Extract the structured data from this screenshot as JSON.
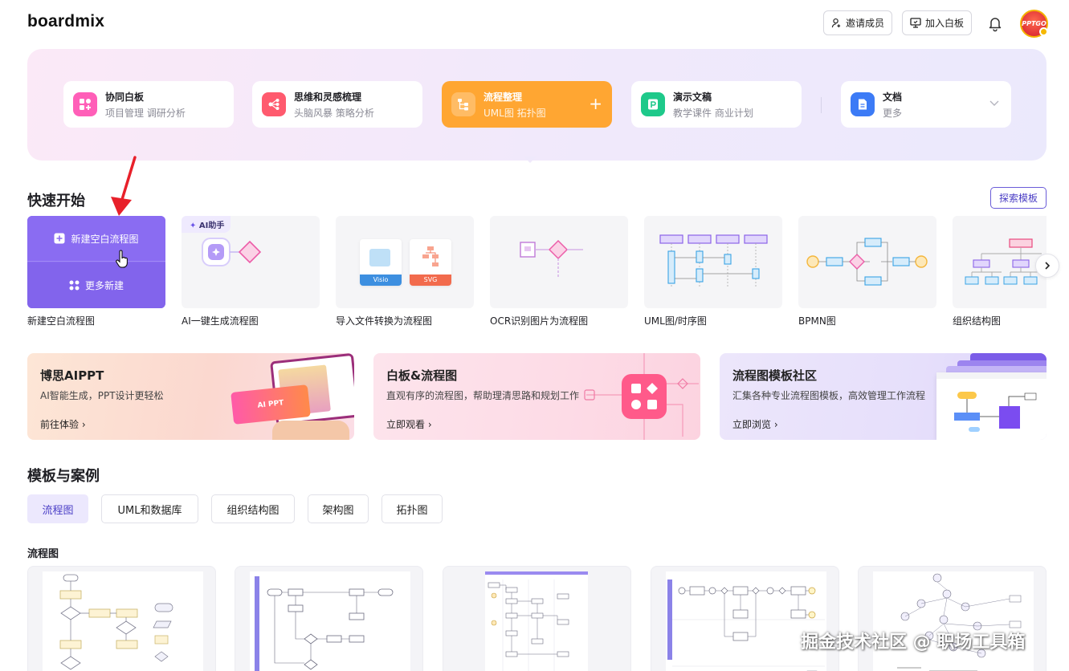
{
  "header": {
    "logo": "boardmix",
    "invite_label": "邀请成员",
    "join_label": "加入白板",
    "avatar_text": "PPTGO"
  },
  "hero": {
    "categories": [
      {
        "title": "协同白板",
        "sub": "项目管理 调研分析",
        "color": "#ff5fb8"
      },
      {
        "title": "思维和灵感梳理",
        "sub": "头脑风暴 策略分析",
        "color": "#ff5a6e"
      },
      {
        "title": "流程整理",
        "sub": "UML图 拓扑图",
        "color": "#ffa632"
      },
      {
        "title": "演示文稿",
        "sub": "教学课件 商业计划",
        "color": "#1ec98a"
      },
      {
        "title": "文档",
        "sub": "更多",
        "color": "#3c7bf6"
      }
    ]
  },
  "quick_start": {
    "title": "快速开始",
    "explore_label": "探索模板",
    "new_blank_label": "新建空白流程图",
    "more_new_label": "更多新建",
    "ai_badge": "AI助手",
    "visio_tag": "Visio",
    "svg_tag": "SVG",
    "cards": [
      {
        "label": "新建空白流程图"
      },
      {
        "label": "AI一键生成流程图"
      },
      {
        "label": "导入文件转换为流程图"
      },
      {
        "label": "OCR识别图片为流程图"
      },
      {
        "label": "UML图/时序图"
      },
      {
        "label": "BPMN图"
      },
      {
        "label": "组织结构图"
      }
    ]
  },
  "promos": [
    {
      "title": "博思AIPPT",
      "sub": "AI智能生成，PPT设计更轻松",
      "link": "前往体验",
      "screen_text": "AI PPT"
    },
    {
      "title": "白板&流程图",
      "sub": "直观有序的流程图，帮助理清思路和规划工作",
      "link": "立即观看"
    },
    {
      "title": "流程图模板社区",
      "sub": "汇集各种专业流程图模板，高效管理工作流程",
      "link": "立即浏览"
    }
  ],
  "templates": {
    "title": "模板与案例",
    "tabs": [
      "流程图",
      "UML和数据库",
      "组织结构图",
      "架构图",
      "拓扑图"
    ],
    "subsection": "流程图"
  },
  "watermark": "掘金技术社区 @ 职场工具箱"
}
